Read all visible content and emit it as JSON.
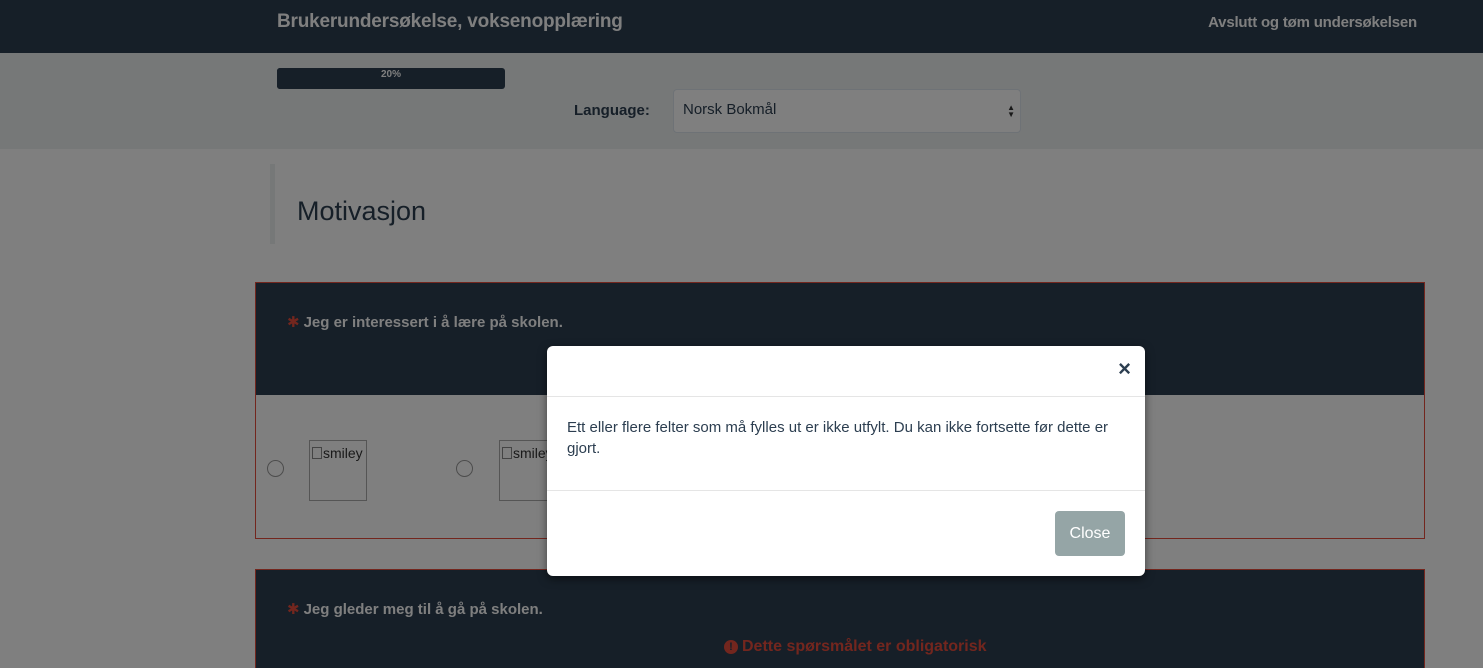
{
  "navbar": {
    "title": "Brukerundersøkelse, voksenopplæring",
    "exit_link": "Avslutt og tøm undersøkelsen"
  },
  "progress": {
    "value_percent": 20,
    "label": "20%"
  },
  "language": {
    "label": "Language:",
    "selected": "Norsk Bokmål"
  },
  "section": {
    "title": "Motivasjon"
  },
  "questions": [
    {
      "required_marker": "✱",
      "text": "Jeg er interessert i å lære på skolen.",
      "options": [
        {
          "image_alt": "smiley"
        },
        {
          "image_alt": "smiley"
        }
      ]
    },
    {
      "required_marker": "✱",
      "text": "Jeg gleder meg til å gå på skolen.",
      "error_icon": "!",
      "error_message": "Dette spørsmålet er obligatorisk"
    }
  ],
  "modal": {
    "close_icon": "×",
    "message": "Ett eller flere felter som må fylles ut er ikke utfylt. Du kan ikke fortsette før dette er gjort.",
    "close_button": "Close"
  },
  "colors": {
    "navbar": "#2c3e50",
    "error": "#e74c3c",
    "close_button": "#95a5a6"
  }
}
